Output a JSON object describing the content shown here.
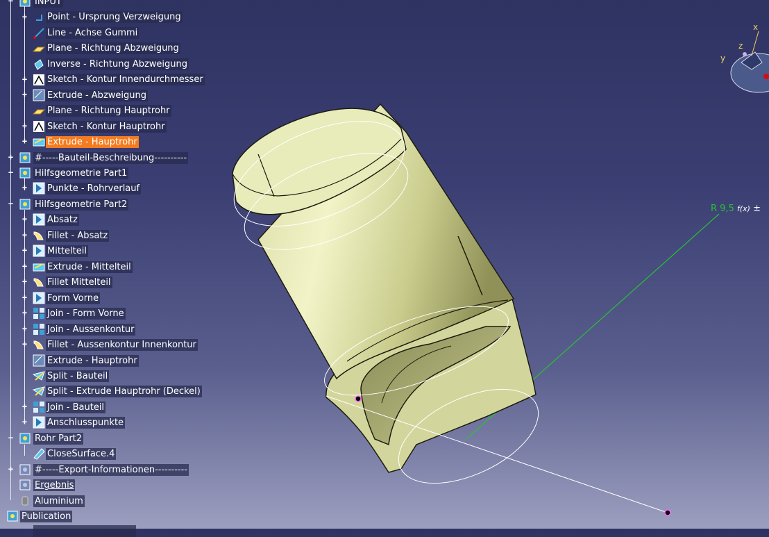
{
  "viewer": {
    "radius_label": "R 9,5",
    "formula_label": "f(x)",
    "pm_label": "±",
    "axes": {
      "x": "x",
      "y": "y",
      "z": "z"
    }
  },
  "tree": {
    "items": [
      {
        "label": "INPUT",
        "icon": "geometrical-set-icon"
      },
      {
        "label": "Point - Ursprung Verzweigung",
        "icon": "point-icon"
      },
      {
        "label": "Line - Achse Gummi",
        "icon": "line-icon"
      },
      {
        "label": "Plane - Richtung Abzweigung",
        "icon": "plane-icon"
      },
      {
        "label": "Inverse - Richtung Abzweigung",
        "icon": "inverse-icon"
      },
      {
        "label": "Sketch - Kontur Innendurchmesser",
        "icon": "sketch-icon"
      },
      {
        "label": "Extrude - Abzweigung",
        "icon": "extrude-icon"
      },
      {
        "label": "Plane - Richtung Hauptrohr",
        "icon": "plane-icon"
      },
      {
        "label": "Sketch - Kontur Hauptrohr",
        "icon": "sketch-icon"
      },
      {
        "label": "Extrude - Hauptrohr",
        "icon": "extrude-icon"
      },
      {
        "label": "#-----Bauteil-Beschreibung----------",
        "icon": "geometrical-set-icon"
      },
      {
        "label": "Hilfsgeometrie Part1",
        "icon": "geometrical-set-icon"
      },
      {
        "label": "Punkte - Rohrverlauf",
        "icon": "points-icon"
      },
      {
        "label": "Hilfsgeometrie Part2",
        "icon": "geometrical-set-icon"
      },
      {
        "label": "Absatz",
        "icon": "surface-icon"
      },
      {
        "label": "Fillet - Absatz",
        "icon": "fillet-icon"
      },
      {
        "label": "Mittelteil",
        "icon": "surface-icon"
      },
      {
        "label": "Extrude - Mittelteil",
        "icon": "extrude-icon"
      },
      {
        "label": "Fillet Mittelteil",
        "icon": "fillet-icon"
      },
      {
        "label": "Form Vorne",
        "icon": "surface-icon"
      },
      {
        "label": "Join - Form Vorne",
        "icon": "join-icon"
      },
      {
        "label": "Join - Aussenkontur",
        "icon": "join-icon"
      },
      {
        "label": "Fillet - Aussenkontur Innenkontur",
        "icon": "fillet-icon"
      },
      {
        "label": "Extrude - Hauptrohr",
        "icon": "extrude-icon"
      },
      {
        "label": "Split - Bauteil",
        "icon": "split-icon"
      },
      {
        "label": "Split - Extrude Hauptrohr (Deckel)",
        "icon": "split-icon"
      },
      {
        "label": "Join - Bauteil",
        "icon": "join-icon"
      },
      {
        "label": "Anschlusspunkte",
        "icon": "points-icon"
      },
      {
        "label": "Rohr Part2",
        "icon": "geometrical-set-icon"
      },
      {
        "label": "CloseSurface.4",
        "icon": "close-surface-icon"
      },
      {
        "label": "#-----Export-Informationen----------",
        "icon": "geometrical-set-icon"
      },
      {
        "label": "Ergebnis",
        "icon": "geometrical-set-icon"
      },
      {
        "label": "Aluminium",
        "icon": "material-icon"
      },
      {
        "label": "Publication",
        "icon": "publication-icon"
      }
    ]
  }
}
